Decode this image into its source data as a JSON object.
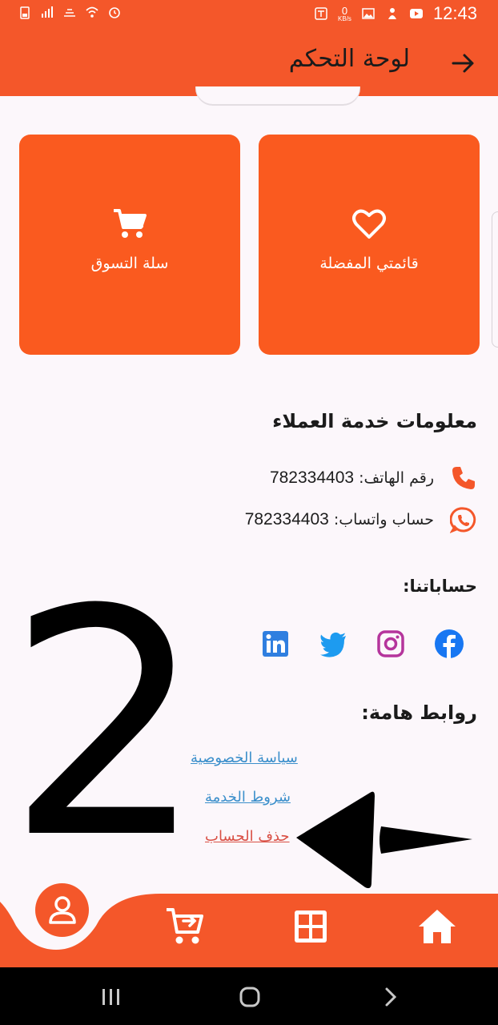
{
  "status_bar": {
    "time": "12:43",
    "data_speed": "0",
    "data_unit": "KB/s"
  },
  "app_bar": {
    "title": "لوحة التحكم",
    "back_icon": "arrow-right-icon"
  },
  "cards": [
    {
      "label": "قائمتي المفضلة",
      "icon": "heart-icon"
    },
    {
      "label": "سلة التسوق",
      "icon": "shopping-cart-icon"
    }
  ],
  "customer_service": {
    "title": "معلومات خدمة العملاء",
    "phone_label": "رقم الهاتف:",
    "phone_value": "782334403",
    "whatsapp_label": "حساب واتساب:",
    "whatsapp_value": "782334403"
  },
  "accounts": {
    "title": "حساباتنا:",
    "items": [
      "facebook-icon",
      "instagram-icon",
      "twitter-icon",
      "linkedin-icon"
    ]
  },
  "important_links": {
    "title": "روابط هامة:",
    "privacy": "سياسة الخصوصية",
    "terms": "شروط الخدمة",
    "delete_account": "حذف الحساب"
  },
  "annotation": {
    "number": "2"
  },
  "bottom_nav": {
    "items": [
      "profile-icon",
      "add-to-cart-icon",
      "grid-icon",
      "home-icon"
    ]
  },
  "colors": {
    "accent": "#f4572a",
    "card": "#fa5a1f",
    "link_blue": "#3b8fcb",
    "link_red": "#d94f44"
  }
}
